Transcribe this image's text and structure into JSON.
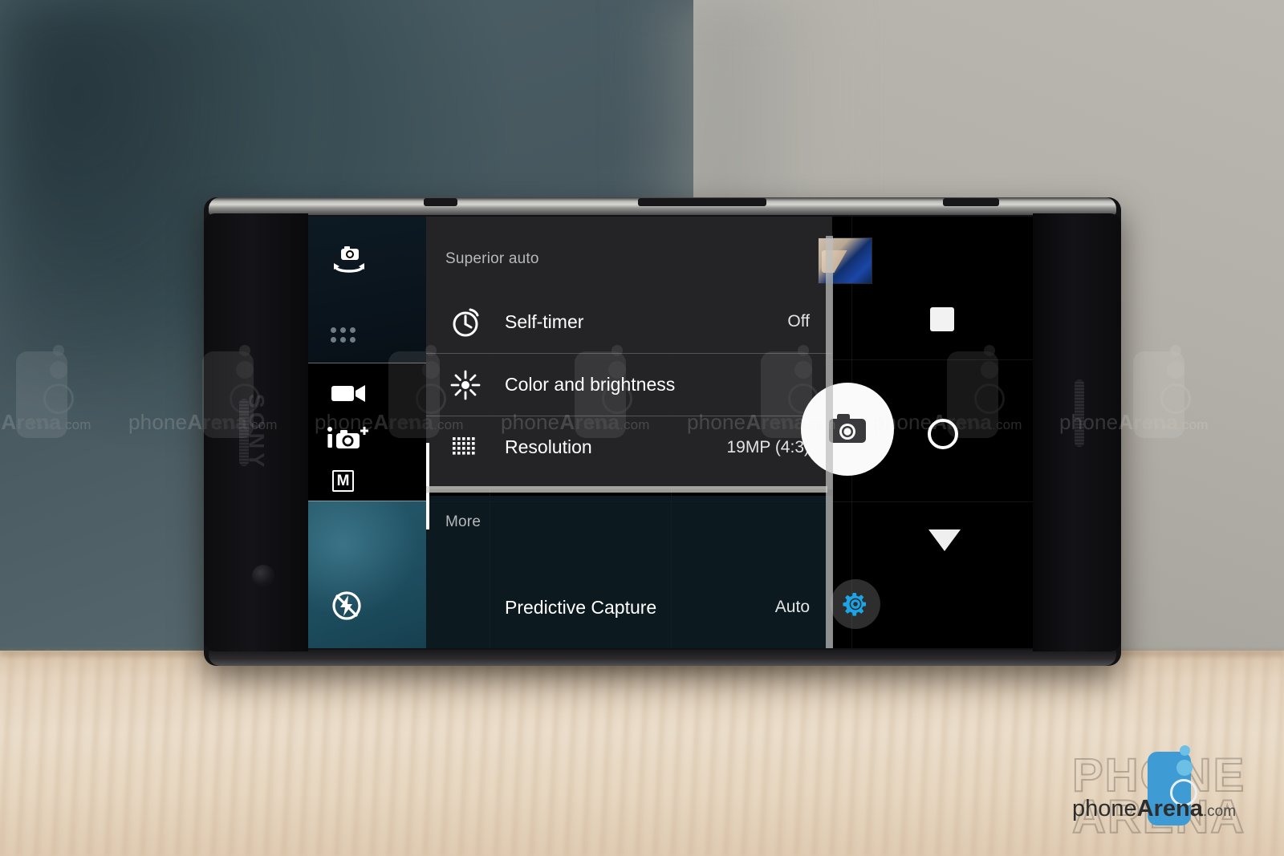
{
  "scene": {
    "device_brand": "SONY",
    "colors": {
      "wall_left": "#47585f",
      "wall_right": "#b3b0a9",
      "table": "#e6d5c0",
      "phone_body": "#121215",
      "accent_blue": "#3e9bd4",
      "menu_panel": "#282829",
      "preview_teal": "#27647a"
    }
  },
  "camera_ui": {
    "mode_strip": {
      "switch_camera_icon": "camera-switch-icon",
      "more_modes_icon": "apps-grid-icon",
      "video_mode_icon": "video-camera-icon",
      "superior_auto_icon": "i-auto-camera-icon",
      "manual_mode_icon": "M",
      "flash_icon": "flash-off-icon"
    },
    "menu": {
      "section_superior": "Superior auto",
      "section_more": "More",
      "rows": [
        {
          "icon": "self-timer-icon",
          "label": "Self-timer",
          "value": "Off"
        },
        {
          "icon": "brightness-icon",
          "label": "Color and brightness",
          "value": ""
        },
        {
          "icon": "resolution-grid-icon",
          "label": "Resolution",
          "value": "19MP (4:3)"
        }
      ],
      "more_rows": [
        {
          "label": "Predictive Capture",
          "value": "Auto"
        }
      ]
    },
    "controls": {
      "thumbnail": "last-photo-thumbnail",
      "record_square": "record-stop-icon",
      "shutter_icon": "camera-shutter-icon",
      "video_record_icon": "video-record-icon",
      "collapse_icon": "triangle-down-icon",
      "settings_icon": "gear-icon"
    }
  },
  "watermark": {
    "prefix": "phone",
    "brand": "Arena",
    "suffix": ".com",
    "outline_text": "PHONE",
    "outline_text2": "ARENA"
  }
}
